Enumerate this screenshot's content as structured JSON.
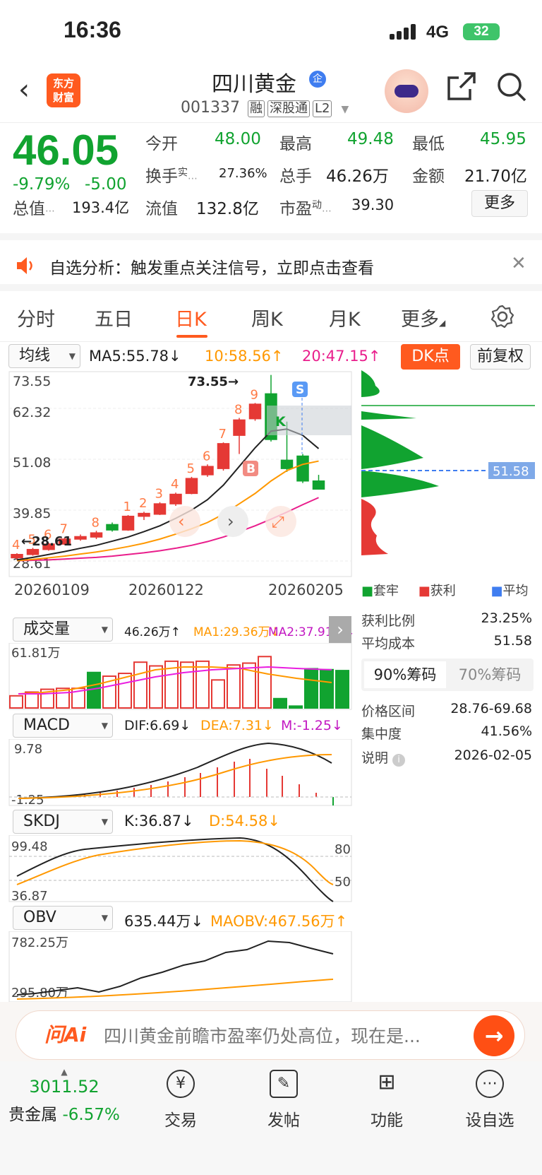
{
  "status_bar": {
    "time": "16:36",
    "network": "4G",
    "battery": "32"
  },
  "header": {
    "stock_name": "四川黄金",
    "enterprise_badge": "企",
    "stock_code": "001337",
    "tags": [
      "融",
      "深股通",
      "L2"
    ],
    "logo_text": [
      "东方",
      "财富"
    ]
  },
  "quote": {
    "price": "46.05",
    "change_pct": "-9.79%",
    "change": "-5.00",
    "open_label": "今开",
    "open": "48.00",
    "high_label": "最高",
    "high": "49.48",
    "low_label": "最低",
    "low": "45.95",
    "turnover_label": "换手",
    "turnover_sup": "实",
    "turnover": "27.36%",
    "volume_label": "总手",
    "volume": "46.26万",
    "amount_label": "金额",
    "amount": "21.70亿",
    "mktcap_label": "总值",
    "mktcap": "193.4亿",
    "float_label": "流值",
    "float_cap": "132.8亿",
    "pe_label": "市盈",
    "pe_sup": "动",
    "pe": "39.30",
    "more_label": "更多"
  },
  "notice": {
    "text": "自选分析：触发重点关注信号，立即点击查看"
  },
  "tabs": [
    {
      "label": "分时",
      "active": false
    },
    {
      "label": "五日",
      "active": false
    },
    {
      "label": "日K",
      "active": true
    },
    {
      "label": "周K",
      "active": false
    },
    {
      "label": "月K",
      "active": false
    },
    {
      "label": "更多",
      "active": false
    }
  ],
  "ma_bar": {
    "selector": "均线",
    "ma5": "MA5:55.78↓",
    "ma10": "10:58.56↑",
    "ma20": "20:47.15↑",
    "dk_button": "DK点",
    "adjust_button": "前复权"
  },
  "colors": {
    "up": "#e53935",
    "down": "#11a330",
    "accent": "#ff5a1f",
    "ma5": "#222222",
    "ma10": "#ff9800",
    "ma20": "#e91e8c"
  },
  "kline": {
    "y_labels": [
      "73.55",
      "62.32",
      "51.08",
      "39.85",
      "28.61"
    ],
    "x_labels": [
      "20260109",
      "20260122",
      "20260205"
    ],
    "high_marker": "73.55",
    "low_marker": "28.61",
    "seq_marks": [
      "4",
      "5",
      "6",
      "7",
      "8",
      "9",
      "1",
      "2",
      "3",
      "4",
      "5",
      "6",
      "7",
      "8",
      "9"
    ],
    "signal_s": "S",
    "signal_b": "B",
    "signal_k": "K",
    "candles": [
      {
        "o": 29.5,
        "c": 30.3,
        "h": 30.6,
        "l": 29.0
      },
      {
        "o": 30.3,
        "c": 31.5,
        "h": 31.9,
        "l": 30.0
      },
      {
        "o": 31.5,
        "c": 32.8,
        "h": 33.1,
        "l": 31.2
      },
      {
        "o": 32.8,
        "c": 34.0,
        "h": 34.4,
        "l": 32.6
      },
      {
        "o": 34.0,
        "c": 34.6,
        "h": 35.1,
        "l": 33.6
      },
      {
        "o": 34.5,
        "c": 35.5,
        "h": 36.0,
        "l": 34.0
      },
      {
        "o": 37.5,
        "c": 36.2,
        "h": 38.0,
        "l": 35.8
      },
      {
        "o": 36.2,
        "c": 39.5,
        "h": 39.8,
        "l": 36.0
      },
      {
        "o": 39.5,
        "c": 40.2,
        "h": 40.6,
        "l": 38.6
      },
      {
        "o": 40.0,
        "c": 42.5,
        "h": 42.9,
        "l": 39.8
      },
      {
        "o": 42.5,
        "c": 44.8,
        "h": 45.2,
        "l": 42.0
      },
      {
        "o": 45.0,
        "c": 48.6,
        "h": 49.0,
        "l": 44.8
      },
      {
        "o": 49.5,
        "c": 51.5,
        "h": 52.0,
        "l": 49.0
      },
      {
        "o": 51.0,
        "c": 57.0,
        "h": 57.3,
        "l": 50.5
      },
      {
        "o": 59.0,
        "c": 62.7,
        "h": 63.2,
        "l": 54.5
      },
      {
        "o": 63.0,
        "c": 66.5,
        "h": 66.8,
        "l": 62.5
      },
      {
        "o": 69.0,
        "c": 58.0,
        "h": 73.55,
        "l": 57.5
      },
      {
        "o": 53.0,
        "c": 51.0,
        "h": 62.3,
        "l": 50.2
      },
      {
        "o": 54.0,
        "c": 48.0,
        "h": 54.5,
        "l": 47.5
      },
      {
        "o": 48.0,
        "c": 46.05,
        "h": 49.48,
        "l": 45.95
      }
    ],
    "ma5": [
      29.0,
      29.6,
      30.3,
      31.0,
      31.8,
      32.5,
      33.5,
      34.5,
      35.8,
      37.2,
      39.0,
      41.0,
      43.5,
      47.0,
      51.5,
      56.0,
      60.0,
      60.5,
      59.0,
      55.8
    ],
    "ma10": [
      28.8,
      29.1,
      29.5,
      29.9,
      30.4,
      30.9,
      31.5,
      32.2,
      33.0,
      34.0,
      35.2,
      36.5,
      38.0,
      40.0,
      42.5,
      45.0,
      48.0,
      50.5,
      52.0,
      52.8
    ],
    "ma20": [
      28.8,
      28.9,
      29.0,
      29.2,
      29.4,
      29.6,
      29.9,
      30.3,
      30.7,
      31.2,
      31.8,
      32.5,
      33.4,
      34.5,
      35.8,
      37.2,
      38.8,
      40.5,
      42.3,
      44.0
    ]
  },
  "chips": {
    "avg_label": "51.58",
    "legend": [
      "套牢",
      "获利",
      "平均"
    ],
    "profit_ratio_label": "获利比例",
    "profit_ratio": "23.25%",
    "avg_cost_label": "平均成本",
    "avg_cost": "51.58",
    "tab_90": "90%筹码",
    "tab_70": "70%筹码",
    "price_range_label": "价格区间",
    "price_range": "28.76-69.68",
    "concentration_label": "集中度",
    "concentration": "41.56%",
    "note_label": "说明",
    "note_date": "2026-02-05"
  },
  "volume": {
    "selector": "成交量",
    "vol": "46.26万↑",
    "ma1": "MA1:29.36万↓",
    "ma2": "MA2:37.91万↓",
    "y_max": "61.81万",
    "bars": [
      13,
      17,
      20,
      21,
      21,
      38,
      34,
      37,
      49,
      45,
      50,
      49,
      50,
      30,
      46,
      48,
      55,
      10,
      2,
      42,
      41,
      40
    ]
  },
  "macd": {
    "selector": "MACD",
    "dif": "DIF:6.69↓",
    "dea": "DEA:7.31↓",
    "m": "M:-1.25↓",
    "y_max": "9.78",
    "y_min": "-1.25"
  },
  "skdj": {
    "selector": "SKDJ",
    "k": "K:36.87↓",
    "d": "D:54.58↓",
    "y_max": "99.48",
    "y_min": "36.87",
    "level_80": "80",
    "level_50": "50"
  },
  "obv": {
    "selector": "OBV",
    "obv": "635.44万↓",
    "maobv": "MAOBV:467.56万↑",
    "y_max": "782.25万",
    "y_min": "295.80万"
  },
  "ai_bar": {
    "logo": "问Ai",
    "text": "四川黄金前瞻市盈率仍处高位，现在是..."
  },
  "bottom_nav": {
    "index_value": "3011.52",
    "index_name": "贵金属",
    "index_change": "-6.57%",
    "items": [
      "交易",
      "发帖",
      "功能",
      "设自选"
    ]
  }
}
